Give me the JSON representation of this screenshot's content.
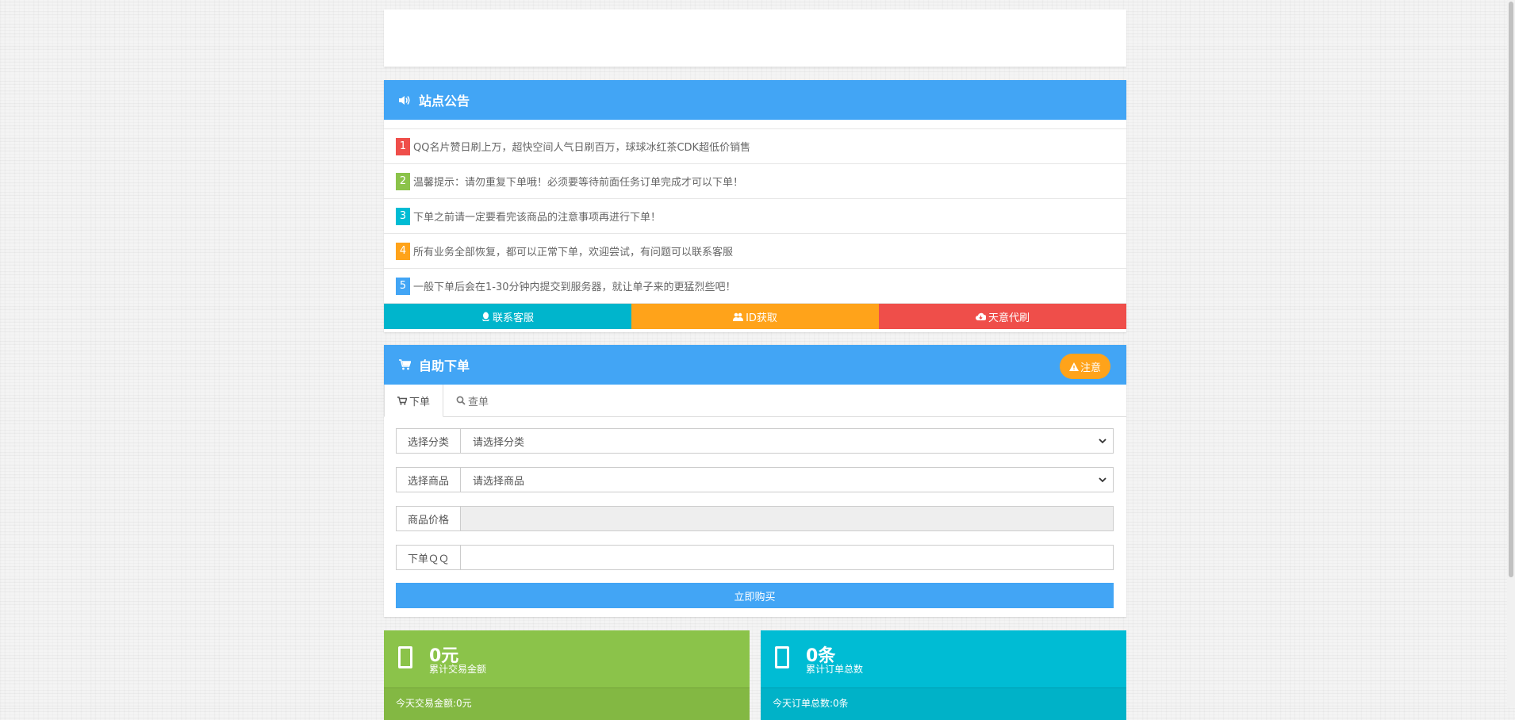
{
  "notice": {
    "title": "站点公告",
    "icon": "volume-icon",
    "items": [
      {
        "num": "1",
        "text": "QQ名片赞日刷上万，超快空间人气日刷百万，球球冰红茶CDK超低价销售"
      },
      {
        "num": "2",
        "text": "温馨提示：请勿重复下单哦！必须要等待前面任务订单完成才可以下单！"
      },
      {
        "num": "3",
        "text": "下单之前请一定要看完该商品的注意事项再进行下单！"
      },
      {
        "num": "4",
        "text": "所有业务全部恢复，都可以正常下单，欢迎尝试，有问题可以联系客服"
      },
      {
        "num": "5",
        "text": "一般下单后会在1-30分钟内提交到服务器，就让单子来的更猛烈些吧！"
      }
    ],
    "buttons": {
      "contact": "联系客服",
      "id_get": "ID获取",
      "tianyi": "天意代刷"
    },
    "colors": {
      "contact": "#00b5cc",
      "id_get": "#ffa31a",
      "tianyi": "#ef4e4a"
    }
  },
  "order": {
    "title": "自助下单",
    "notice_button": "注意",
    "tabs": [
      {
        "label": "下单"
      },
      {
        "label": "查单"
      }
    ],
    "fields": {
      "category_label": "选择分类",
      "category_value": "请选择分类",
      "product_label": "选择商品",
      "product_value": "请选择商品",
      "price_label": "商品价格",
      "price_value": "",
      "qq_label": "下单ＱＱ",
      "qq_value": ""
    },
    "buy_button": "立即购买"
  },
  "stats": [
    {
      "value": "0元",
      "label": "累计交易金额",
      "footer": "今天交易金额:0元",
      "color": "#8bc34a"
    },
    {
      "value": "0条",
      "label": "累计订单总数",
      "footer": "今天订单总数:0条",
      "color": "#00bcd4"
    }
  ],
  "theme": {
    "primary": "#42a5f5"
  }
}
